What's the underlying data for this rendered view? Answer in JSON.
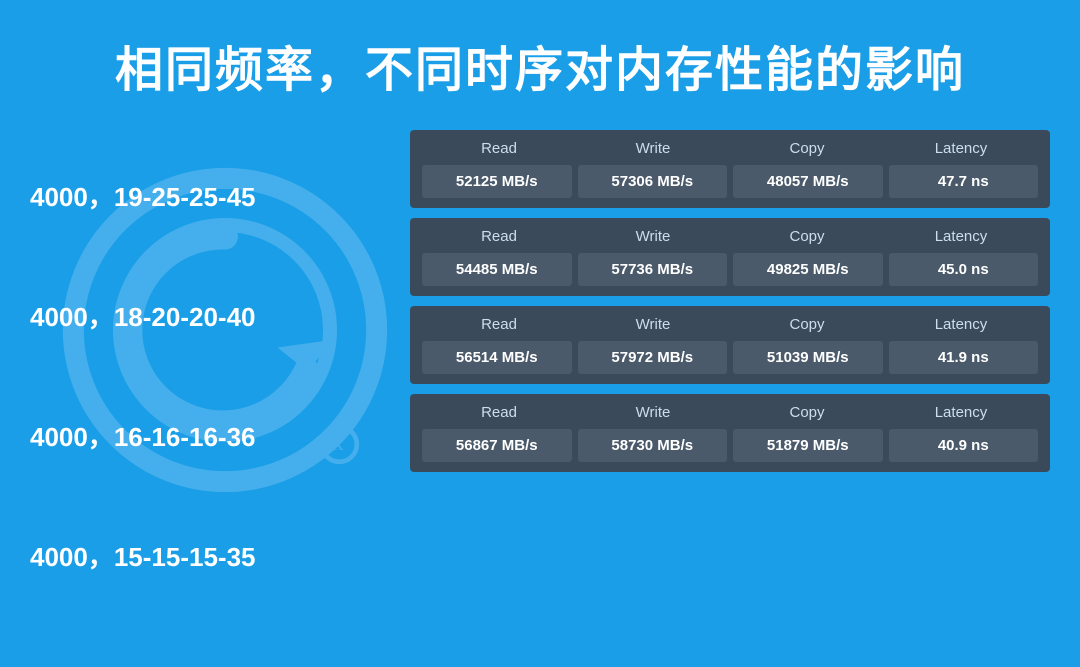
{
  "title": "相同频率，不同时序对内存性能的影响",
  "rows": [
    {
      "label": "4000，19-25-25-45",
      "read": "52125 MB/s",
      "write": "57306 MB/s",
      "copy": "48057 MB/s",
      "latency": "47.7 ns"
    },
    {
      "label": "4000，18-20-20-40",
      "read": "54485 MB/s",
      "write": "57736 MB/s",
      "copy": "49825 MB/s",
      "latency": "45.0 ns"
    },
    {
      "label": "4000，16-16-16-36",
      "read": "56514 MB/s",
      "write": "57972 MB/s",
      "copy": "51039 MB/s",
      "latency": "41.9 ns"
    },
    {
      "label": "4000，15-15-15-35",
      "read": "56867 MB/s",
      "write": "58730 MB/s",
      "copy": "51879 MB/s",
      "latency": "40.9 ns"
    }
  ],
  "columns": [
    "Read",
    "Write",
    "Copy",
    "Latency"
  ]
}
